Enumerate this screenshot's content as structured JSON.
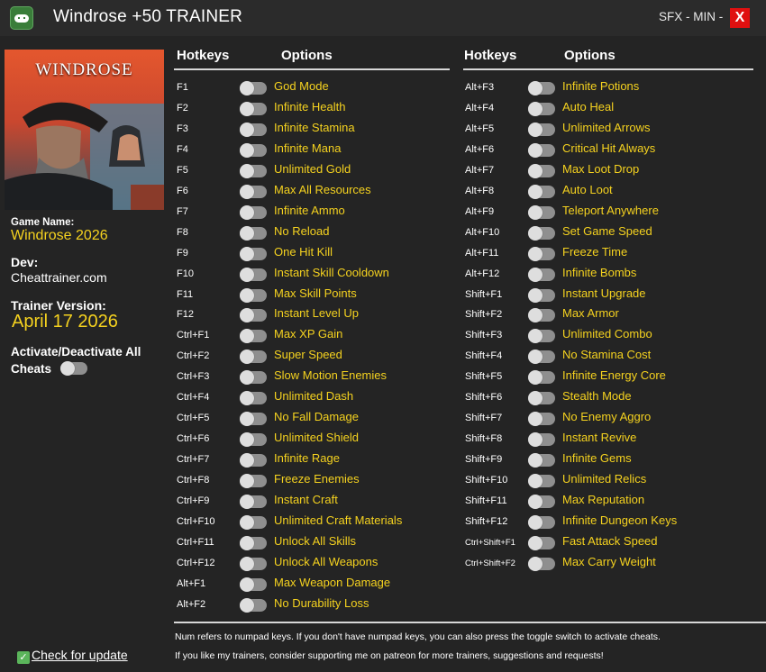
{
  "window": {
    "title": "Windrose +50 TRAINER",
    "controls": "SFX - MIN -",
    "close_label": "X",
    "icon": "gamepad-icon"
  },
  "sidebar": {
    "cover_logo": "WINDROSE",
    "game_name_label": "Game Name:",
    "game_name": "Windrose 2026",
    "dev_label": "Dev:",
    "dev": "Cheattrainer.com",
    "trainer_version_label": "Trainer Version:",
    "trainer_version": "April 17 2026",
    "activate_all_label": "Activate/Deactivate All Cheats",
    "update_link": "Check for update"
  },
  "headers": {
    "hotkeys": "Hotkeys",
    "options": "Options"
  },
  "cheats_left": [
    {
      "hotkey": "F1",
      "option": "God Mode"
    },
    {
      "hotkey": "F2",
      "option": "Infinite Health"
    },
    {
      "hotkey": "F3",
      "option": "Infinite Stamina"
    },
    {
      "hotkey": "F4",
      "option": "Infinite Mana"
    },
    {
      "hotkey": "F5",
      "option": "Unlimited Gold"
    },
    {
      "hotkey": "F6",
      "option": "Max All Resources"
    },
    {
      "hotkey": "F7",
      "option": "Infinite Ammo"
    },
    {
      "hotkey": "F8",
      "option": "No Reload"
    },
    {
      "hotkey": "F9",
      "option": "One Hit Kill"
    },
    {
      "hotkey": "F10",
      "option": "Instant Skill Cooldown"
    },
    {
      "hotkey": "F11",
      "option": "Max Skill Points"
    },
    {
      "hotkey": "F12",
      "option": "Instant Level Up"
    },
    {
      "hotkey": "Ctrl+F1",
      "option": "Max XP Gain"
    },
    {
      "hotkey": "Ctrl+F2",
      "option": "Super Speed"
    },
    {
      "hotkey": "Ctrl+F3",
      "option": "Slow Motion Enemies"
    },
    {
      "hotkey": "Ctrl+F4",
      "option": "Unlimited Dash"
    },
    {
      "hotkey": "Ctrl+F5",
      "option": "No Fall Damage"
    },
    {
      "hotkey": "Ctrl+F6",
      "option": "Unlimited Shield"
    },
    {
      "hotkey": "Ctrl+F7",
      "option": "Infinite Rage"
    },
    {
      "hotkey": "Ctrl+F8",
      "option": "Freeze Enemies"
    },
    {
      "hotkey": "Ctrl+F9",
      "option": "Instant Craft"
    },
    {
      "hotkey": "Ctrl+F10",
      "option": "Unlimited Craft Materials"
    },
    {
      "hotkey": "Ctrl+F11",
      "option": "Unlock All Skills"
    },
    {
      "hotkey": "Ctrl+F12",
      "option": "Unlock All Weapons"
    },
    {
      "hotkey": "Alt+F1",
      "option": "Max Weapon Damage"
    },
    {
      "hotkey": "Alt+F2",
      "option": "No Durability Loss"
    }
  ],
  "cheats_right": [
    {
      "hotkey": "Alt+F3",
      "option": "Infinite Potions"
    },
    {
      "hotkey": "Alt+F4",
      "option": "Auto Heal"
    },
    {
      "hotkey": "Alt+F5",
      "option": "Unlimited Arrows"
    },
    {
      "hotkey": "Alt+F6",
      "option": "Critical Hit Always"
    },
    {
      "hotkey": "Alt+F7",
      "option": "Max Loot Drop"
    },
    {
      "hotkey": "Alt+F8",
      "option": "Auto Loot"
    },
    {
      "hotkey": "Alt+F9",
      "option": "Teleport Anywhere"
    },
    {
      "hotkey": "Alt+F10",
      "option": "Set Game Speed"
    },
    {
      "hotkey": "Alt+F11",
      "option": "Freeze Time"
    },
    {
      "hotkey": "Alt+F12",
      "option": "Infinite Bombs"
    },
    {
      "hotkey": "Shift+F1",
      "option": "Instant Upgrade"
    },
    {
      "hotkey": "Shift+F2",
      "option": "Max Armor"
    },
    {
      "hotkey": "Shift+F3",
      "option": "Unlimited Combo"
    },
    {
      "hotkey": "Shift+F4",
      "option": "No Stamina Cost"
    },
    {
      "hotkey": "Shift+F5",
      "option": "Infinite Energy Core"
    },
    {
      "hotkey": "Shift+F6",
      "option": "Stealth Mode"
    },
    {
      "hotkey": "Shift+F7",
      "option": "No Enemy Aggro"
    },
    {
      "hotkey": "Shift+F8",
      "option": "Instant Revive"
    },
    {
      "hotkey": "Shift+F9",
      "option": "Infinite Gems"
    },
    {
      "hotkey": "Shift+F10",
      "option": "Unlimited Relics"
    },
    {
      "hotkey": "Shift+F11",
      "option": "Max Reputation"
    },
    {
      "hotkey": "Shift+F12",
      "option": "Infinite Dungeon Keys"
    },
    {
      "hotkey": "Ctrl+Shift+F1",
      "option": "Fast Attack Speed"
    },
    {
      "hotkey": "Ctrl+Shift+F2",
      "option": "Max Carry Weight"
    }
  ],
  "footer": {
    "note1": "Num refers to numpad keys. If you don't have numpad keys, you can also press the toggle switch to activate cheats.",
    "note2": "If you like my trainers, consider supporting me on patreon for more trainers, suggestions and requests!"
  },
  "colors": {
    "background": "#242424",
    "titlebar": "#2b2b2b",
    "accent_yellow": "#f5d21f",
    "close_red": "#e01010"
  }
}
